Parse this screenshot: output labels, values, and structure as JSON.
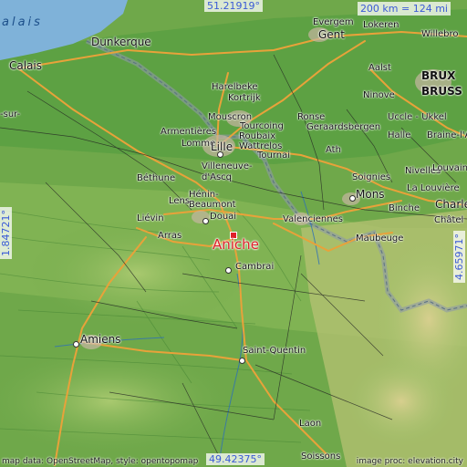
{
  "map": {
    "top_latitude": "51.21919°",
    "bottom_latitude": "49.42375°",
    "left_longitude": "1.84721°",
    "right_longitude": "4.65971°",
    "scale_text": "200 km = 124 mi",
    "highlight_place": "Aniche",
    "sea_label": "alais",
    "attribution_left": "map data: OpenStreetMap, style: opentopomap",
    "attribution_right": "image proc: elevation.city",
    "colors": {
      "lowland": "#6fa84a",
      "upland": "#c8c27a",
      "highland": "#b8a77a",
      "sea": "#7fb2d9",
      "marker": "#e0202a",
      "coord_text": "#3b5bd6"
    }
  },
  "places": {
    "gent": "Gent",
    "evergem": "Evergem",
    "lokeren": "Lokeren",
    "willebro": "Willebro",
    "aalst": "Aalst",
    "brux": "BRUX",
    "bruss": "BRUSS",
    "ninove": "Ninove",
    "uccle": "Uccle - Ukkel",
    "halle": "Halle",
    "braine": "Braine-l'Alleud",
    "dunkerque": "Dunkerque",
    "calais": "Calais",
    "sur": "-sur-",
    "harelbeke": "Harelbeke",
    "kortrijk": "Kortrijk",
    "mouscron": "Mouscron",
    "tourcoing": "Tourcoing",
    "roubaix": "Roubaix",
    "wattrelos": "Wattrelos",
    "ronse": "Ronse",
    "geraardsbergen": "Geraardsbergen",
    "armentieres": "Armentières",
    "lomme": "Lomme",
    "lille": "Lille",
    "tournai": "Tournai",
    "ath": "Ath",
    "villeneuve": "Villeneuve-",
    "dascq": "d'Ascq",
    "bethune": "Béthune",
    "soignies": "Soignies",
    "nivelles": "Nivelles",
    "louvain": "Louvain-",
    "lalouviere": "La Louvière",
    "henin": "Hénin-",
    "beaumont": "Beaumont",
    "lens": "Lens",
    "mons": "Mons",
    "charle": "Charle",
    "lievin": "Liévin",
    "douai": "Douai",
    "valenciennes": "Valenciennes",
    "binche": "Binche",
    "chatel": "Châtel",
    "arras": "Arras",
    "maubeuge": "Maubeuge",
    "cambrai": "Cambrai",
    "amiens": "Amiens",
    "saintquentin": "Saint-Quentin",
    "laon": "Laon",
    "soissons": "Soissons"
  }
}
